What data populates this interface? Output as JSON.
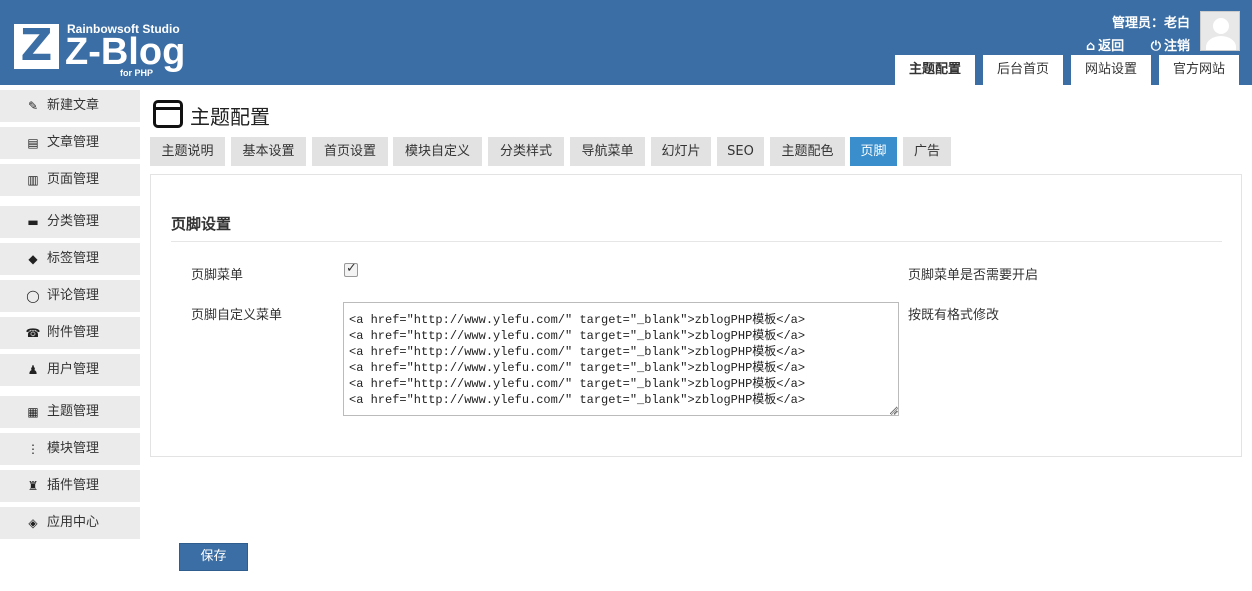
{
  "logo": {
    "studio": "Rainbowsoft Studio",
    "name": "Z-Blog",
    "sub": "for PHP"
  },
  "user": {
    "label": "管理员：老白",
    "back": "返回",
    "logout": "注销"
  },
  "top_tabs": [
    {
      "label": "主题配置",
      "active": true
    },
    {
      "label": "后台首页",
      "active": false
    },
    {
      "label": "网站设置",
      "active": false
    },
    {
      "label": "官方网站",
      "active": false
    }
  ],
  "sidebar": {
    "items": [
      {
        "label": "新建文章",
        "icon": "edit-icon"
      },
      {
        "label": "文章管理",
        "icon": "document-icon"
      },
      {
        "label": "页面管理",
        "icon": "page-icon"
      },
      {
        "label": "分类管理",
        "icon": "folder-icon"
      },
      {
        "label": "标签管理",
        "icon": "tag-icon"
      },
      {
        "label": "评论管理",
        "icon": "comment-icon"
      },
      {
        "label": "附件管理",
        "icon": "attachment-icon"
      },
      {
        "label": "用户管理",
        "icon": "user-icon"
      },
      {
        "label": "主题管理",
        "icon": "theme-icon"
      },
      {
        "label": "模块管理",
        "icon": "module-icon"
      },
      {
        "label": "插件管理",
        "icon": "plugin-icon"
      },
      {
        "label": "应用中心",
        "icon": "app-center-icon"
      }
    ]
  },
  "page": {
    "title": "主题配置"
  },
  "sub_tabs": [
    {
      "label": "主题说明",
      "active": false
    },
    {
      "label": "基本设置",
      "active": false
    },
    {
      "label": "首页设置",
      "active": false
    },
    {
      "label": "模块自定义",
      "active": false
    },
    {
      "label": "分类样式",
      "active": false
    },
    {
      "label": "导航菜单",
      "active": false
    },
    {
      "label": "幻灯片",
      "active": false
    },
    {
      "label": "SEO",
      "active": false
    },
    {
      "label": "主题配色",
      "active": false
    },
    {
      "label": "页脚",
      "active": true
    },
    {
      "label": "广告",
      "active": false
    }
  ],
  "footer_settings": {
    "section_title": "页脚设置",
    "menu_label": "页脚菜单",
    "menu_checked": true,
    "menu_desc": "页脚菜单是否需要开启",
    "custom_label": "页脚自定义菜单",
    "custom_value": "<a href=\"http://www.ylefu.com/\" target=\"_blank\">zblogPHP模板</a>\n<a href=\"http://www.ylefu.com/\" target=\"_blank\">zblogPHP模板</a>\n<a href=\"http://www.ylefu.com/\" target=\"_blank\">zblogPHP模板</a>\n<a href=\"http://www.ylefu.com/\" target=\"_blank\">zblogPHP模板</a>\n<a href=\"http://www.ylefu.com/\" target=\"_blank\">zblogPHP模板</a>\n<a href=\"http://www.ylefu.com/\" target=\"_blank\">zblogPHP模板</a>",
    "custom_desc": "按既有格式修改"
  },
  "save_label": "保存",
  "colors": {
    "header": "#3a6ea5",
    "active_tab": "#3a8ecb",
    "sidebar_item": "#ebebeb"
  }
}
